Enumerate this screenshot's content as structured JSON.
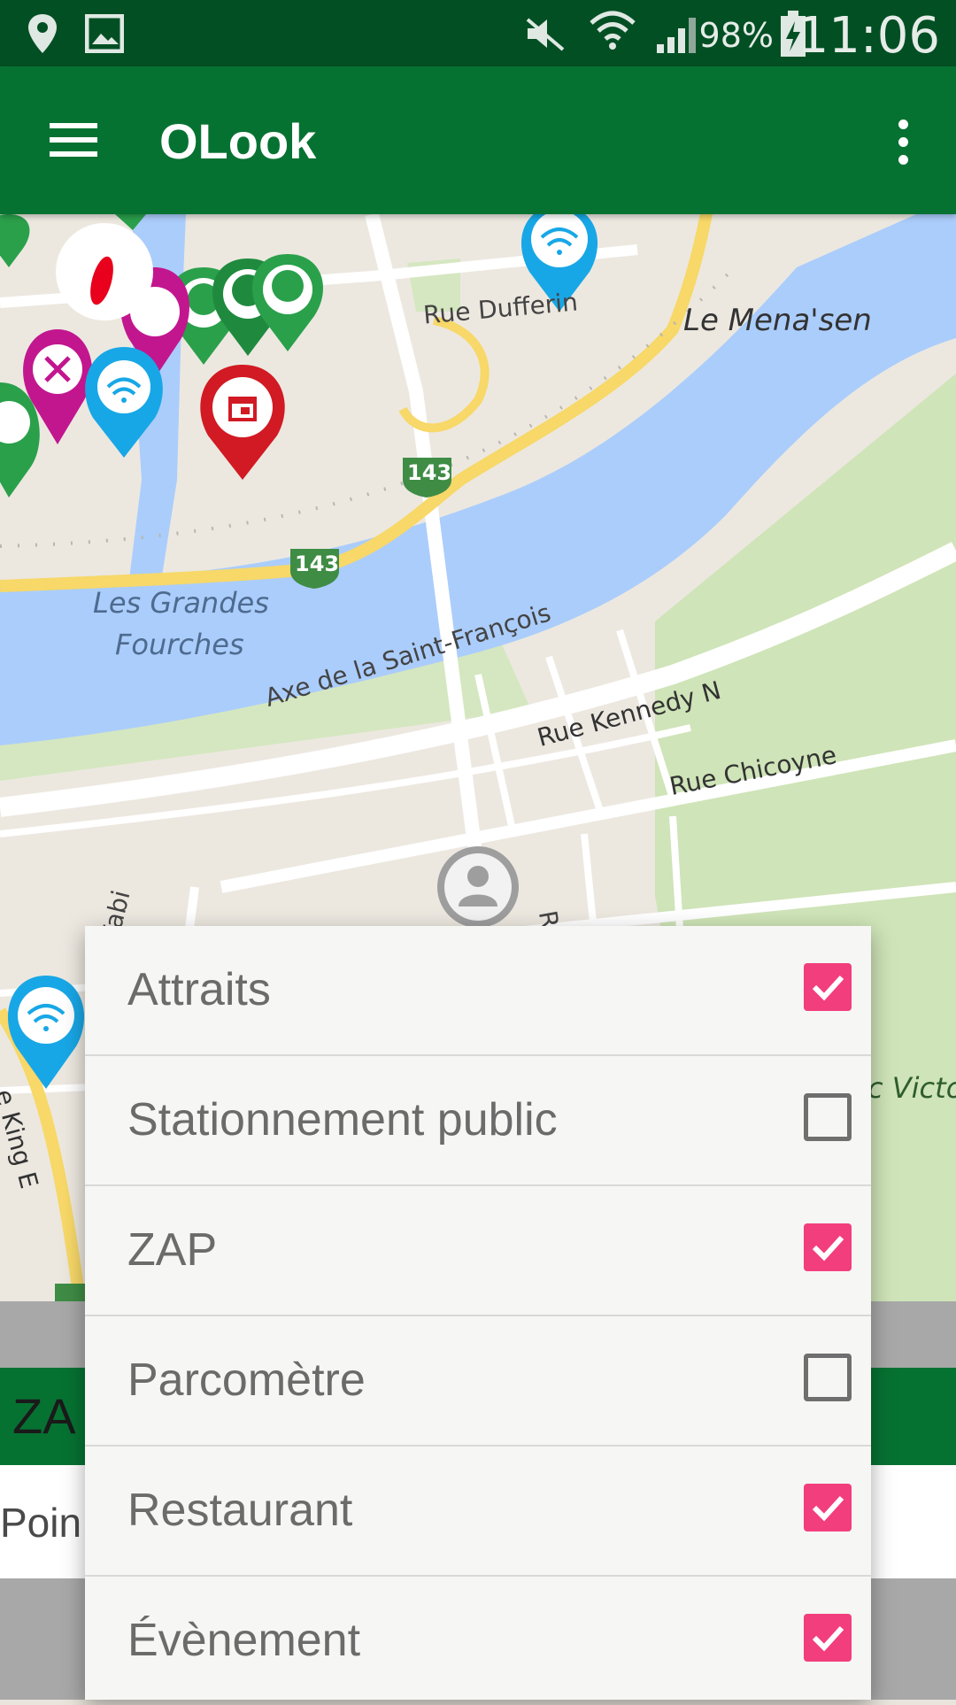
{
  "status_bar": {
    "battery_percent": "98%",
    "time": "11:06",
    "icons": [
      "location-pin-icon",
      "gallery-icon",
      "mute-icon",
      "wifi-icon",
      "signal-icon",
      "battery-charging-icon"
    ]
  },
  "app_bar": {
    "title": "OLook",
    "menu_icon": "hamburger-menu-icon",
    "overflow_icon": "more-vert-icon",
    "color": "#067232"
  },
  "map": {
    "labels": {
      "rue_dufferin": "Rue Dufferin",
      "le_menasen": "Le Mena'sen",
      "grandes_fourches_1": "Les Grandes",
      "grandes_fourches_2": "Fourches",
      "axe": "Axe de la Saint-François",
      "rue_kennedy": "Rue Kennedy N",
      "rue_chicoyne": "Rue Chicoyne",
      "route_143_a": "143",
      "route_143_b": "143",
      "fabi": "Fabi",
      "king": "e King E",
      "parc_victoria": "c Victo",
      "partial_r": "R"
    },
    "markers": [
      "tree-marker-icon",
      "restaurant-marker-icon",
      "wifi-marker-icon",
      "event-marker-icon",
      "user-location-icon"
    ]
  },
  "background": {
    "green_band_text": "ZA",
    "white_band_text": "Poin"
  },
  "filters": [
    {
      "label": "Attraits",
      "checked": true
    },
    {
      "label": "Stationnement public",
      "checked": false
    },
    {
      "label": "ZAP",
      "checked": true
    },
    {
      "label": "Parcomètre",
      "checked": false
    },
    {
      "label": "Restaurant",
      "checked": true
    },
    {
      "label": "Évènement",
      "checked": true
    }
  ],
  "colors": {
    "checkbox_checked": "#f23e7d",
    "status_bar": "#024f24",
    "river": "#abcdfb"
  }
}
